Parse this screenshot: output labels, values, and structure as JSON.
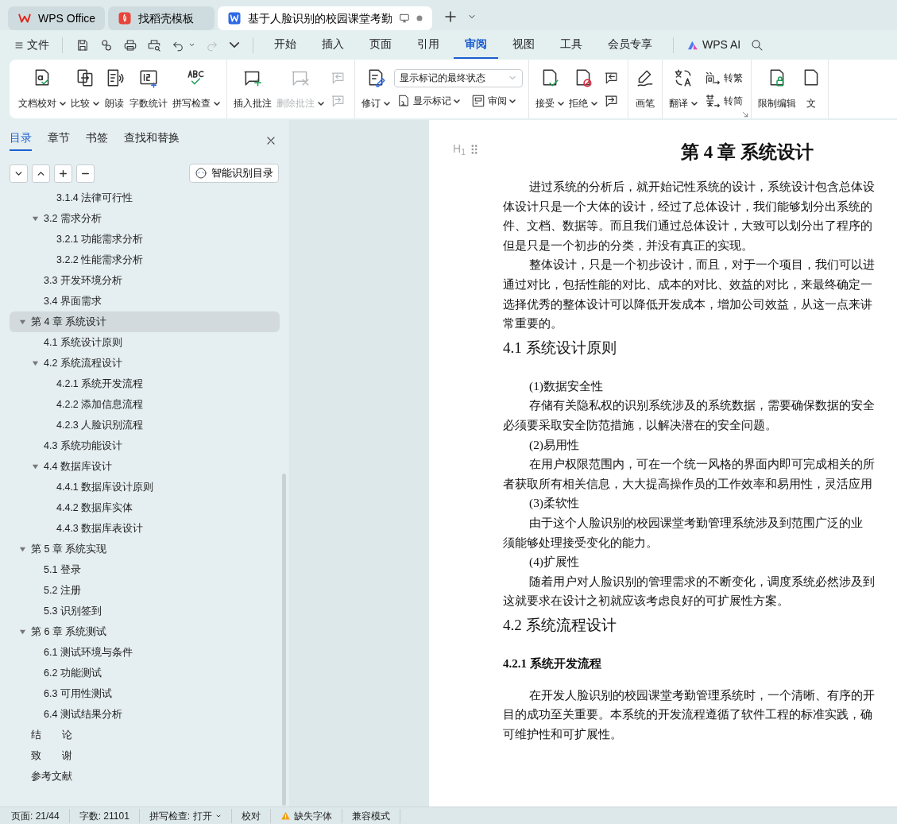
{
  "tab_bar": {
    "tabs": [
      {
        "label": "WPS Office",
        "kind": "home",
        "selected": false
      },
      {
        "label": "找稻壳模板",
        "kind": "template",
        "selected": false
      },
      {
        "label": "基于人脸识别的校园课堂考勤",
        "kind": "document",
        "selected": true,
        "unsaved": true
      }
    ]
  },
  "menu_bar": {
    "file_label": "文件",
    "quick_tools": [
      {
        "kind": "save",
        "disabled": false
      },
      {
        "kind": "format",
        "disabled": false
      },
      {
        "kind": "print",
        "disabled": false
      },
      {
        "kind": "preview",
        "disabled": false
      },
      {
        "kind": "undo",
        "disabled": false
      },
      {
        "kind": "redo",
        "disabled": true
      },
      {
        "kind": "more",
        "disabled": false
      }
    ],
    "menu_tabs": [
      {
        "label": "开始",
        "selected": false
      },
      {
        "label": "插入",
        "selected": false
      },
      {
        "label": "页面",
        "selected": false
      },
      {
        "label": "引用",
        "selected": false
      },
      {
        "label": "审阅",
        "selected": true
      },
      {
        "label": "视图",
        "selected": false
      },
      {
        "label": "工具",
        "selected": false
      },
      {
        "label": "会员专享",
        "selected": false
      }
    ],
    "ai_label": "WPS AI"
  },
  "ribbon": {
    "groups": [
      {
        "items": [
          {
            "kind": "proofread",
            "label": "文档校对",
            "caret": true,
            "disabled": false
          },
          {
            "kind": "compare",
            "label": "比较",
            "caret": true,
            "disabled": false
          },
          {
            "kind": "read_aloud",
            "label": "朗读",
            "disabled": false
          },
          {
            "kind": "word_count",
            "label": "字数统计",
            "disabled": false
          },
          {
            "kind": "spell_check",
            "label": "拼写检查",
            "caret": true,
            "disabled": false
          }
        ]
      },
      {
        "items": [
          {
            "kind": "comment_add",
            "label": "插入批注",
            "disabled": false
          },
          {
            "kind": "comment_delete",
            "label": "删除批注",
            "caret": true,
            "disabled": true
          },
          {
            "kind": "icon_stack",
            "items": [
              {
                "kind": "prev_comment",
                "disabled": true
              },
              {
                "kind": "next_comment",
                "disabled": true
              }
            ]
          }
        ]
      },
      {
        "items": [
          {
            "kind": "track_changes",
            "label": "修订",
            "caret": true,
            "disabled": false
          },
          {
            "kind": "combo_stack",
            "select": "显示标记的最终状态",
            "items": [
              {
                "kind": "markup",
                "label": "显示标记",
                "caret": true
              },
              {
                "kind": "pane",
                "label": "审阅",
                "caret": true
              }
            ]
          }
        ]
      },
      {
        "items": [
          {
            "kind": "accept",
            "label": "接受",
            "caret": true,
            "disabled": false
          },
          {
            "kind": "reject",
            "label": "拒绝",
            "caret": true,
            "disabled": false
          },
          {
            "kind": "icon_stack",
            "items": [
              {
                "kind": "prev_change",
                "disabled": false
              },
              {
                "kind": "next_change",
                "disabled": false
              }
            ]
          }
        ]
      },
      {
        "items": [
          {
            "kind": "pen",
            "label": "画笔",
            "disabled": false
          }
        ]
      },
      {
        "launcher": true,
        "items": [
          {
            "kind": "translate",
            "label": "翻译",
            "caret": true,
            "disabled": false
          },
          {
            "kind": "text_stack",
            "items": [
              {
                "kind": "to_traditional",
                "label": "转繁"
              },
              {
                "kind": "to_simplified",
                "label": "转简"
              }
            ]
          }
        ]
      },
      {
        "items": [
          {
            "kind": "restrict",
            "label": "限制编辑",
            "disabled": false
          },
          {
            "kind": "document",
            "label": "文",
            "disabled": false
          }
        ]
      }
    ]
  },
  "side_panel": {
    "tabs": [
      {
        "label": "目录",
        "selected": true
      },
      {
        "label": "章节",
        "selected": false
      },
      {
        "label": "书签",
        "selected": false
      },
      {
        "label": "查找和替换",
        "selected": false
      }
    ],
    "tools": [
      {
        "kind": "collapse"
      },
      {
        "kind": "expand"
      },
      {
        "kind": "add"
      },
      {
        "kind": "remove"
      }
    ],
    "smart_button": "智能识别目录",
    "toc": [
      {
        "children": [
          {
            "children": [
              {
                "label": "3.1.4  法律可行性",
                "selected": false
              }
            ]
          },
          {
            "label": "3.2 需求分析",
            "selected": false,
            "expanded": true,
            "children": [
              {
                "label": "3.2.1  功能需求分析",
                "selected": false
              },
              {
                "label": "3.2.2  性能需求分析",
                "selected": false
              }
            ]
          },
          {
            "label": "3.3 开发环境分析",
            "selected": false
          },
          {
            "label": "3.4 界面需求",
            "selected": false
          }
        ]
      },
      {
        "label": "第 4 章  系统设计",
        "selected": true,
        "expanded": true,
        "children": [
          {
            "label": "4.1 系统设计原则",
            "selected": false
          },
          {
            "label": "4.2 系统流程设计",
            "selected": false,
            "expanded": true,
            "children": [
              {
                "label": "4.2.1 系统开发流程",
                "selected": false
              },
              {
                "label": "4.2.2  添加信息流程",
                "selected": false
              },
              {
                "label": "4.2.3  人脸识别流程",
                "selected": false
              }
            ]
          },
          {
            "label": "4.3  系统功能设计",
            "selected": false
          },
          {
            "label": "4.4  数据库设计",
            "selected": false,
            "expanded": true,
            "children": [
              {
                "label": "4.4.1  数据库设计原则",
                "selected": false
              },
              {
                "label": "4.4.2  数据库实体",
                "selected": false
              },
              {
                "label": "4.4.3  数据库表设计",
                "selected": false
              }
            ]
          }
        ]
      },
      {
        "label": "第 5 章  系统实现",
        "selected": false,
        "expanded": true,
        "children": [
          {
            "label": "5.1  登录",
            "selected": false
          },
          {
            "label": "5.2  注册",
            "selected": false
          },
          {
            "label": "5.3  识别签到",
            "selected": false
          }
        ]
      },
      {
        "label": "第 6 章  系统测试",
        "selected": false,
        "expanded": true,
        "children": [
          {
            "label": "6.1 测试环境与条件",
            "selected": false
          },
          {
            "label": "6.2 功能测试",
            "selected": false
          },
          {
            "label": "6.3 可用性测试",
            "selected": false
          },
          {
            "label": "6.4 测试结果分析",
            "selected": false
          }
        ]
      },
      {
        "label": "结　　论",
        "selected": false
      },
      {
        "label": "致　　谢",
        "selected": false
      },
      {
        "label": "参考文献",
        "selected": false
      }
    ]
  },
  "document": {
    "heading_marker": "H$_{1}$",
    "blocks": [
      {
        "kind": "title",
        "text": "第 4 章  系统设计"
      },
      {
        "kind": "paragraph",
        "lines": [
          "进过系统的分析后，就开始记性系统的设计，系统设计包含总体设",
          "体设计只是一个大体的设计，经过了总体设计，我们能够划分出系统的",
          "件、文档、数据等。而且我们通过总体设计，大致可以划分出了程序的",
          "但是只是一个初步的分类，并没有真正的实现。"
        ]
      },
      {
        "kind": "paragraph",
        "lines": [
          "整体设计，只是一个初步设计，而且，对于一个项目，我们可以进",
          "通过对比，包括性能的对比、成本的对比、效益的对比，来最终确定一",
          "选择优秀的整体设计可以降低开发成本，增加公司效益，从这一点来讲",
          "常重要的。"
        ]
      },
      {
        "kind": "heading",
        "text": "4.1 系统设计原则"
      },
      {
        "kind": "item",
        "text": "(1)数据安全性"
      },
      {
        "kind": "paragraph",
        "lines": [
          "存储有关隐私权的识别系统涉及的系统数据，需要确保数据的安全",
          "必须要采取安全防范措施，以解决潜在的安全问题。"
        ]
      },
      {
        "kind": "item",
        "text": "(2)易用性"
      },
      {
        "kind": "paragraph",
        "lines": [
          "在用户权限范围内，可在一个统一风格的界面内即可完成相关的所",
          "者获取所有相关信息，大大提高操作员的工作效率和易用性，灵活应用"
        ]
      },
      {
        "kind": "item",
        "text": "(3)柔软性"
      },
      {
        "kind": "paragraph",
        "lines": [
          "由于这个人脸识别的校园课堂考勤管理系统涉及到范围广泛的业",
          "须能够处理接受变化的能力。"
        ]
      },
      {
        "kind": "item",
        "text": "(4)扩展性"
      },
      {
        "kind": "paragraph",
        "lines": [
          "随着用户对人脸识别的管理需求的不断变化，调度系统必然涉及到",
          "这就要求在设计之初就应该考虑良好的可扩展性方案。"
        ]
      },
      {
        "kind": "heading",
        "text": "4.2 系统流程设计"
      },
      {
        "kind": "subheading",
        "text": "4.2.1 系统开发流程"
      },
      {
        "kind": "paragraph",
        "lines": [
          "在开发人脸识别的校园课堂考勤管理系统时，一个清晰、有序的开",
          "目的成功至关重要。本系统的开发流程遵循了软件工程的标准实践，确",
          "可维护性和可扩展性。"
        ]
      }
    ]
  },
  "status_bar": {
    "items": [
      {
        "kind": "text",
        "label": "页面: 21/44"
      },
      {
        "kind": "text",
        "label": "字数: 21101"
      },
      {
        "kind": "dropdown",
        "label": "拼写检查: 打开"
      },
      {
        "kind": "text",
        "label": "校对"
      },
      {
        "kind": "warning",
        "label": "缺失字体"
      },
      {
        "kind": "text",
        "label": "兼容模式"
      }
    ]
  }
}
